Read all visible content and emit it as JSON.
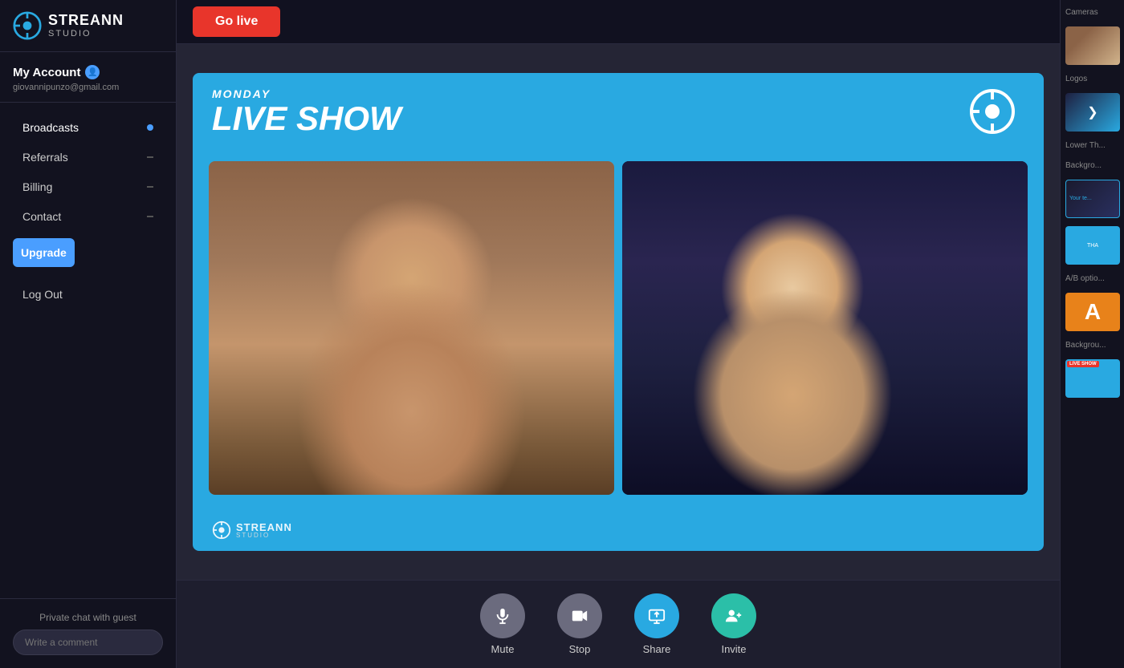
{
  "sidebar": {
    "logo": {
      "streann": "STREANN",
      "studio": "STUDIO"
    },
    "account": {
      "title": "My Account",
      "email": "giovannipunzo@gmail.com"
    },
    "nav": {
      "broadcasts": "Broadcasts",
      "referrals": "Referrals",
      "billing": "Billing",
      "contact": "Contact"
    },
    "upgrade_label": "Upgrade",
    "logout_label": "Log Out",
    "private_chat_label": "Private chat with guest",
    "comment_placeholder": "Write a comment"
  },
  "topbar": {
    "go_live": "Go live"
  },
  "stage": {
    "day": "MONDAY",
    "title": "LIVE SHOW"
  },
  "controls": {
    "mute": "Mute",
    "stop": "Stop",
    "share": "Share",
    "invite": "Invite"
  },
  "right_panel": {
    "cameras_label": "Cameras",
    "logos_label": "Logos",
    "lower_third_label": "Lower Th...",
    "background_label": "Backgro...",
    "ab_options_label": "A/B optio...",
    "background2_label": "Backgrou...",
    "lower_text": "Your te...",
    "lower_text2": "THA",
    "ab_letter": "A"
  },
  "watermark": {
    "streann": "STREANN",
    "studio": "STUDIO"
  }
}
